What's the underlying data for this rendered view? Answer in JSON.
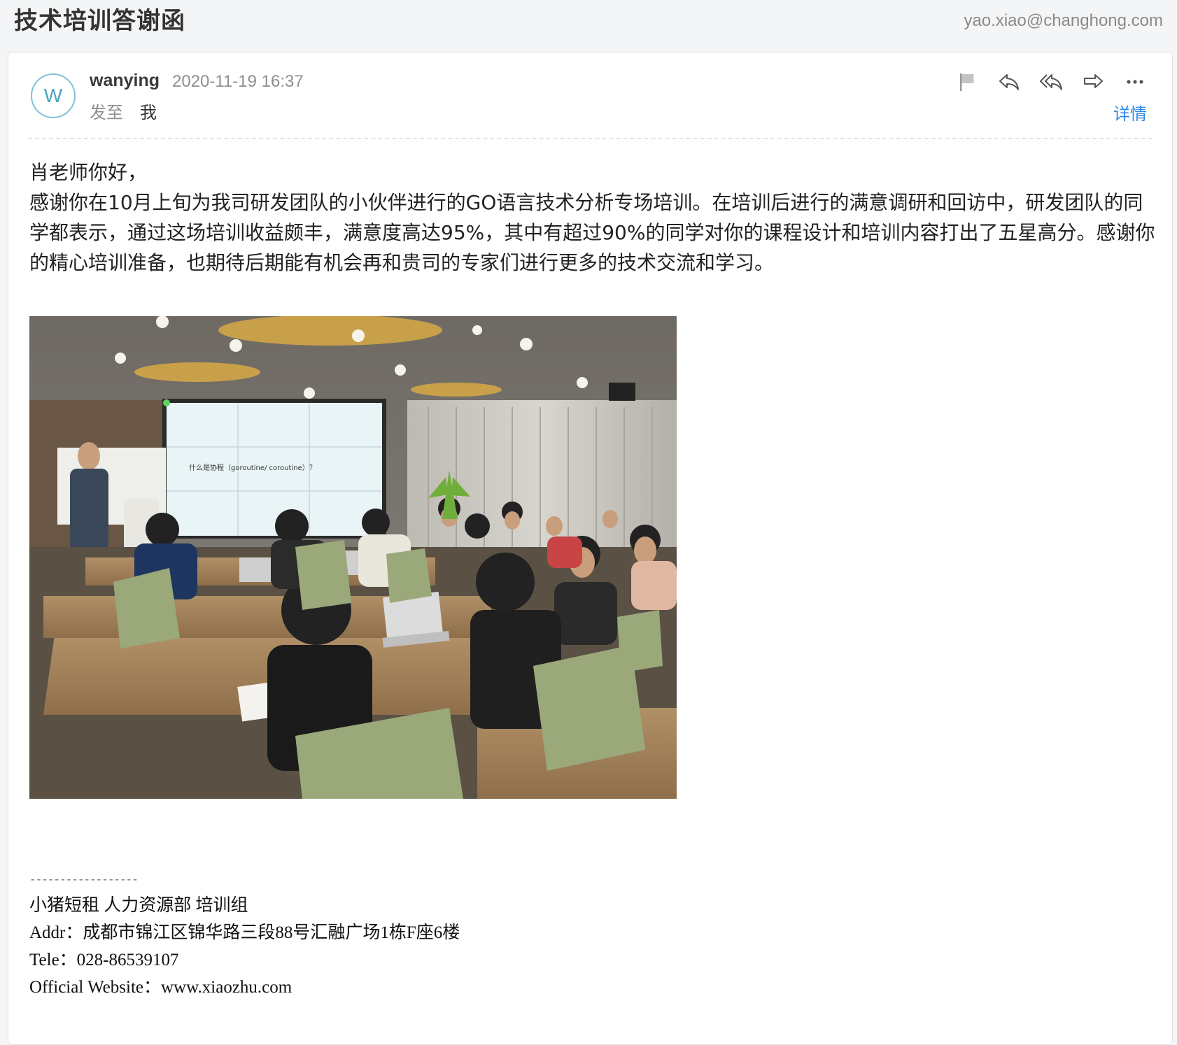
{
  "email": {
    "subject": "技术培训答谢函",
    "account": "yao.xiao@changhong.com",
    "sender": {
      "avatar_letter": "W",
      "name": "wanying",
      "date": "2020-11-19 16:37"
    },
    "to_label": "发至",
    "to_name": "我",
    "actions": [
      {
        "name": "flag",
        "icon": "flag-icon"
      },
      {
        "name": "reply",
        "icon": "reply-icon"
      },
      {
        "name": "reply-all",
        "icon": "reply-all-icon"
      },
      {
        "name": "forward",
        "icon": "forward-icon"
      },
      {
        "name": "more",
        "icon": "more-icon"
      }
    ],
    "details_label": "详情",
    "body": {
      "greeting": "肖老师你好，",
      "paragraph": "感谢你在10月上旬为我司研发团队的小伙伴进行的GO语言技术分析专场培训。在培训后进行的满意调研和回访中，研发团队的同学都表示，通过这场培训收益颇丰，满意度高达95%，其中有超过90%的同学对你的课程设计和培训内容打出了五星高分。感谢你的精心培训准备，也期待后期能有机会再和贵司的专家们进行更多的技术交流和学习。"
    },
    "photo": {
      "screen_text": "什么是协程（goroutine/ coroutine）？"
    },
    "signature": {
      "rule": "------------------",
      "line1": "小猪短租  人力资源部  培训组",
      "line2": "Addr：成都市锦江区锦华路三段88号汇融广场1栋F座6楼",
      "line3": "Tele：028-86539107",
      "line4": "Official Website：www.xiaozhu.com"
    }
  }
}
